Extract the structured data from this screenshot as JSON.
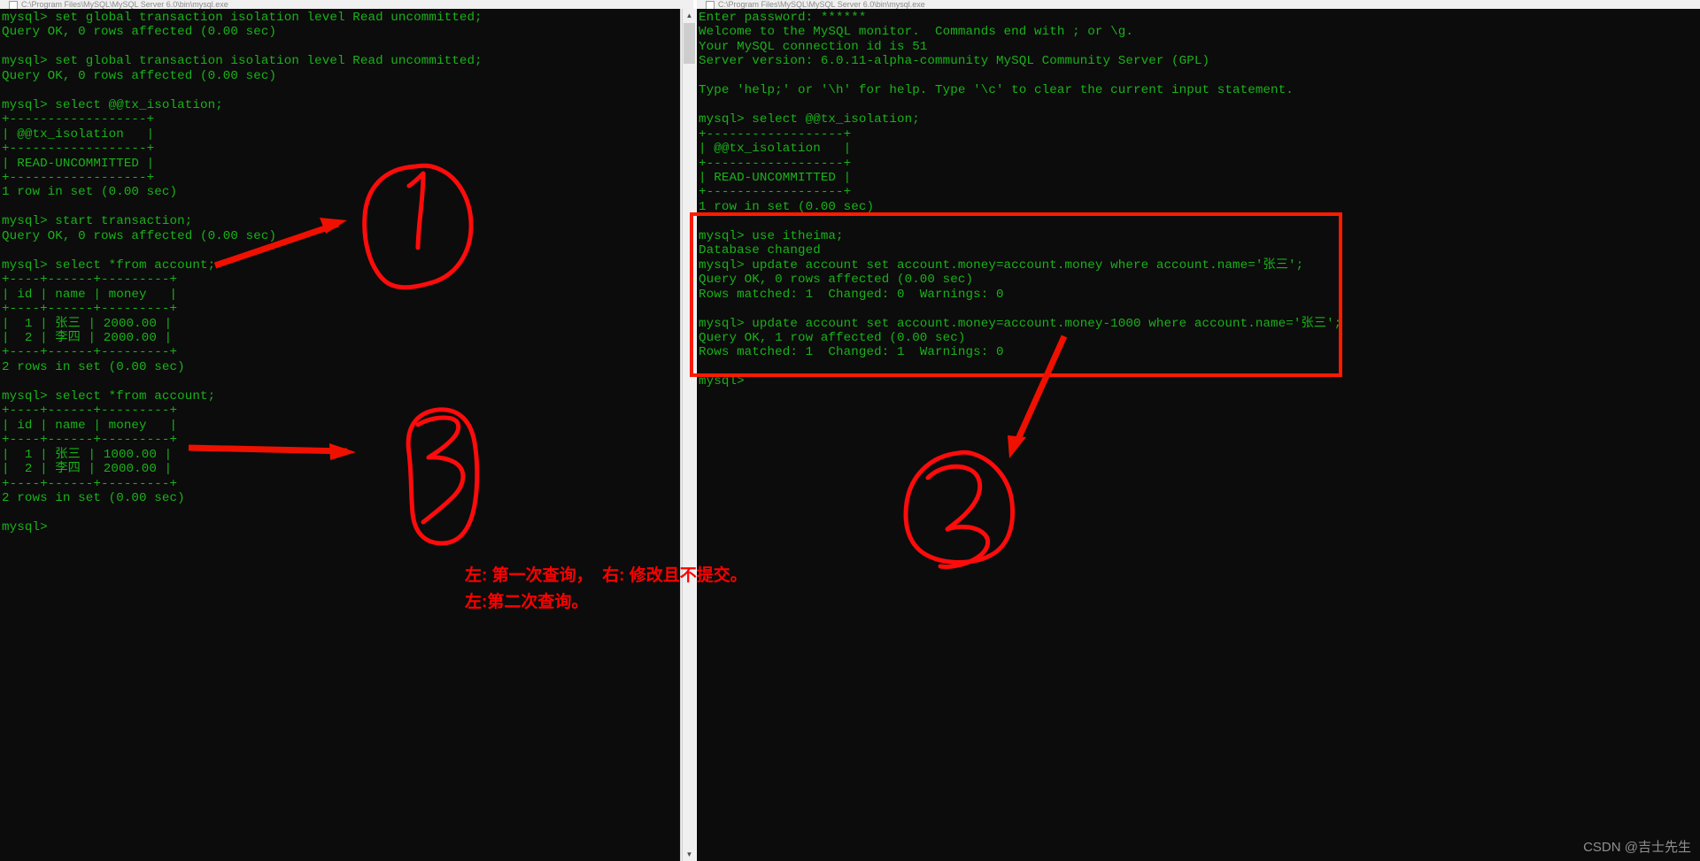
{
  "window_left": {
    "title": "C:\\Program Files\\MySQL\\MySQL Server 6.0\\bin\\mysql.exe",
    "icon": "console-window-icon",
    "terminal_text": "mysql> set global transaction isolation level Read uncommitted;\nQuery OK, 0 rows affected (0.00 sec)\n\nmysql> set global transaction isolation level Read uncommitted;\nQuery OK, 0 rows affected (0.00 sec)\n\nmysql> select @@tx_isolation;\n+------------------+\n| @@tx_isolation   |\n+------------------+\n| READ-UNCOMMITTED |\n+------------------+\n1 row in set (0.00 sec)\n\nmysql> start transaction;\nQuery OK, 0 rows affected (0.00 sec)\n\nmysql> select *from account;\n+----+------+---------+\n| id | name | money   |\n+----+------+---------+\n|  1 | 张三 | 2000.00 |\n|  2 | 李四 | 2000.00 |\n+----+------+---------+\n2 rows in set (0.00 sec)\n\nmysql> select *from account;\n+----+------+---------+\n| id | name | money   |\n+----+------+---------+\n|  1 | 张三 | 1000.00 |\n|  2 | 李四 | 2000.00 |\n+----+------+---------+\n2 rows in set (0.00 sec)\n\nmysql>"
  },
  "window_right": {
    "title": "C:\\Program Files\\MySQL\\MySQL Server 6.0\\bin\\mysql.exe",
    "icon": "console-window-icon",
    "terminal_text": "Enter password: ******\nWelcome to the MySQL monitor.  Commands end with ; or \\g.\nYour MySQL connection id is 51\nServer version: 6.0.11-alpha-community MySQL Community Server (GPL)\n\nType 'help;' or '\\h' for help. Type '\\c' to clear the current input statement.\n\nmysql> select @@tx_isolation;\n+------------------+\n| @@tx_isolation   |\n+------------------+\n| READ-UNCOMMITTED |\n+------------------+\n1 row in set (0.00 sec)\n\nmysql> use itheima;\nDatabase changed\nmysql> update account set account.money=account.money where account.name='张三';\nQuery OK, 0 rows affected (0.00 sec)\nRows matched: 1  Changed: 0  Warnings: 0\n\nmysql> update account set account.money=account.money-1000 where account.name='张三';\nQuery OK, 1 row affected (0.00 sec)\nRows matched: 1  Changed: 1  Warnings: 0\n\nmysql>"
  },
  "annotations": {
    "note_line1": "左: 第一次查询，  右: 修改且不提交。",
    "note_line2": "左:第二次查询。",
    "circled_digit_1": "1",
    "circled_digit_3": "3",
    "circled_digit_2": "2",
    "highlight_color": "#ff0000",
    "arrow_color": "#f01000"
  },
  "watermark": {
    "text": "CSDN @吉士先生"
  },
  "scrollbars": {
    "left": {
      "up_arrow": "▲",
      "down_arrow": "▼"
    },
    "right": {
      "up_arrow": "▲",
      "down_arrow": "▼"
    }
  }
}
